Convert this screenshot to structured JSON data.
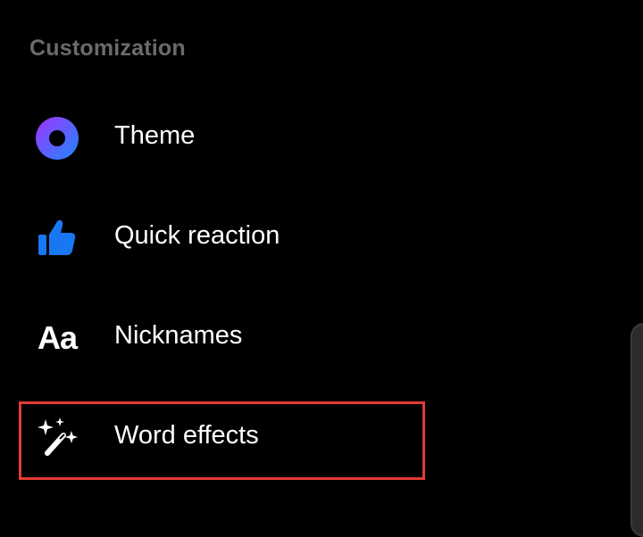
{
  "section": {
    "title": "Customization"
  },
  "items": [
    {
      "label": "Theme",
      "icon": "theme-ring-icon"
    },
    {
      "label": "Quick reaction",
      "icon": "thumbs-up-icon"
    },
    {
      "label": "Nicknames",
      "icon": "aa-text-icon",
      "glyph": "Aa"
    },
    {
      "label": "Word effects",
      "icon": "magic-wand-sparkles-icon"
    }
  ],
  "colors": {
    "background": "#000000",
    "header_text": "#6b6b6b",
    "label_text": "#ffffff",
    "theme_gradient_start": "#a033ff",
    "theme_gradient_end": "#1e88ff",
    "thumbs_up": "#1877f2",
    "highlight": "#e53935"
  }
}
